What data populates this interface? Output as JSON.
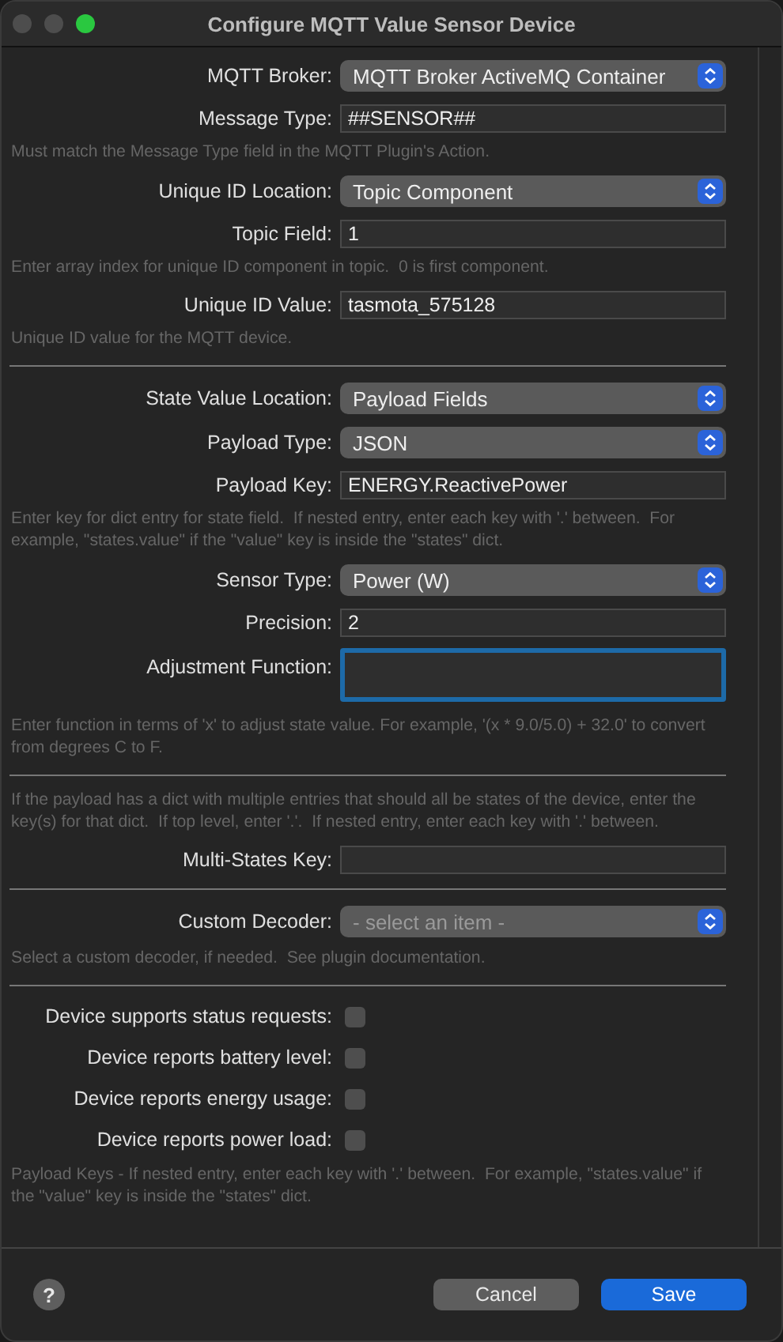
{
  "window": {
    "title": "Configure MQTT Value Sensor Device"
  },
  "items": [
    {
      "kind": "popup",
      "label": "MQTT Broker:",
      "value": "MQTT Broker ActiveMQ Container"
    },
    {
      "kind": "text",
      "label": "Message Type:",
      "value": "##SENSOR##"
    },
    {
      "kind": "note",
      "text": "Must match the Message Type field in the MQTT Plugin's Action."
    },
    {
      "kind": "popup",
      "label": "Unique ID Location:",
      "value": "Topic Component"
    },
    {
      "kind": "text",
      "label": "Topic Field:",
      "value": "1"
    },
    {
      "kind": "note",
      "text": "Enter array index for unique ID component in topic.  0 is first component."
    },
    {
      "kind": "text",
      "label": "Unique ID Value:",
      "value": "tasmota_575128"
    },
    {
      "kind": "note",
      "text": "Unique ID value for the MQTT device."
    },
    {
      "kind": "divider"
    },
    {
      "kind": "popup",
      "label": "State Value Location:",
      "value": "Payload Fields"
    },
    {
      "kind": "popup",
      "label": "Payload Type:",
      "value": "JSON"
    },
    {
      "kind": "text",
      "label": "Payload Key:",
      "value": "ENERGY.ReactivePower"
    },
    {
      "kind": "note",
      "text": "Enter key for dict entry for state field.  If nested entry, enter each key with '.' between.  For example, \"states.value\" if the \"value\" key is inside the \"states\" dict."
    },
    {
      "kind": "popup",
      "label": "Sensor Type:",
      "value": "Power (W)"
    },
    {
      "kind": "text",
      "label": "Precision:",
      "value": "2"
    },
    {
      "kind": "textarea",
      "label": "Adjustment Function:",
      "focused": true
    },
    {
      "kind": "note",
      "text": "Enter function in terms of 'x' to adjust state value. For example, '(x * 9.0/5.0) + 32.0' to convert from degrees C to F."
    },
    {
      "kind": "divider"
    },
    {
      "kind": "note",
      "text": "If the payload has a dict with multiple entries that should all be states of the device, enter the key(s) for that dict.  If top level, enter '.'.  If nested entry, enter each key with '.' between."
    },
    {
      "kind": "text",
      "label": "Multi-States Key:"
    },
    {
      "kind": "divider"
    },
    {
      "kind": "popup",
      "label": "Custom Decoder:",
      "placeholder": "- select an item -"
    },
    {
      "kind": "note",
      "text": "Select a custom decoder, if needed.  See plugin documentation."
    },
    {
      "kind": "divider"
    },
    {
      "kind": "checkbox",
      "label": "Device supports status requests:",
      "checked": false
    },
    {
      "kind": "checkbox",
      "label": "Device reports battery level:",
      "checked": false
    },
    {
      "kind": "checkbox",
      "label": "Device reports energy usage:",
      "checked": false
    },
    {
      "kind": "checkbox",
      "label": "Device reports power load:",
      "checked": false
    },
    {
      "kind": "note",
      "text": "Payload Keys - If nested entry, enter each key with '.' between.  For example, \"states.value\" if the \"value\" key is inside the \"states\" dict."
    }
  ],
  "footer": {
    "help": "?",
    "buttons": [
      {
        "label": "Cancel",
        "default": false
      },
      {
        "label": "Save",
        "default": true
      }
    ]
  }
}
